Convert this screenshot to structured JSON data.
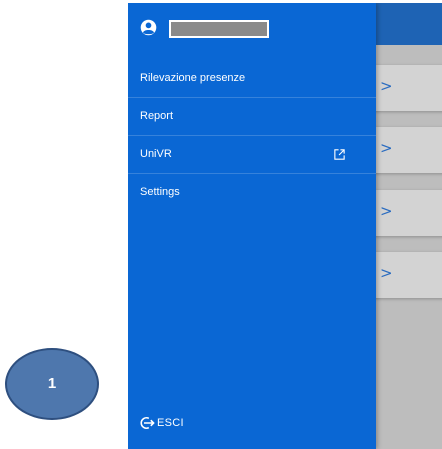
{
  "drawer": {
    "username": "",
    "items": [
      {
        "label": "Rilevazione presenze",
        "external": false
      },
      {
        "label": "Report",
        "external": false
      },
      {
        "label": "UniVR",
        "external": true
      },
      {
        "label": "Settings",
        "external": false
      }
    ],
    "logout_label": "ESCI"
  },
  "background": {
    "card_chevron": ">"
  },
  "annotation": {
    "badge_number": "1"
  },
  "colors": {
    "drawer_bg": "#0a67d4",
    "header_bg": "#1e63b4",
    "overlay_bg": "#bdbdbd",
    "badge_bg": "#4e77ad"
  },
  "icons": {
    "account": "account-circle-icon",
    "external": "open-in-new-icon",
    "logout": "logout-icon",
    "chevron": "chevron-right-icon"
  }
}
